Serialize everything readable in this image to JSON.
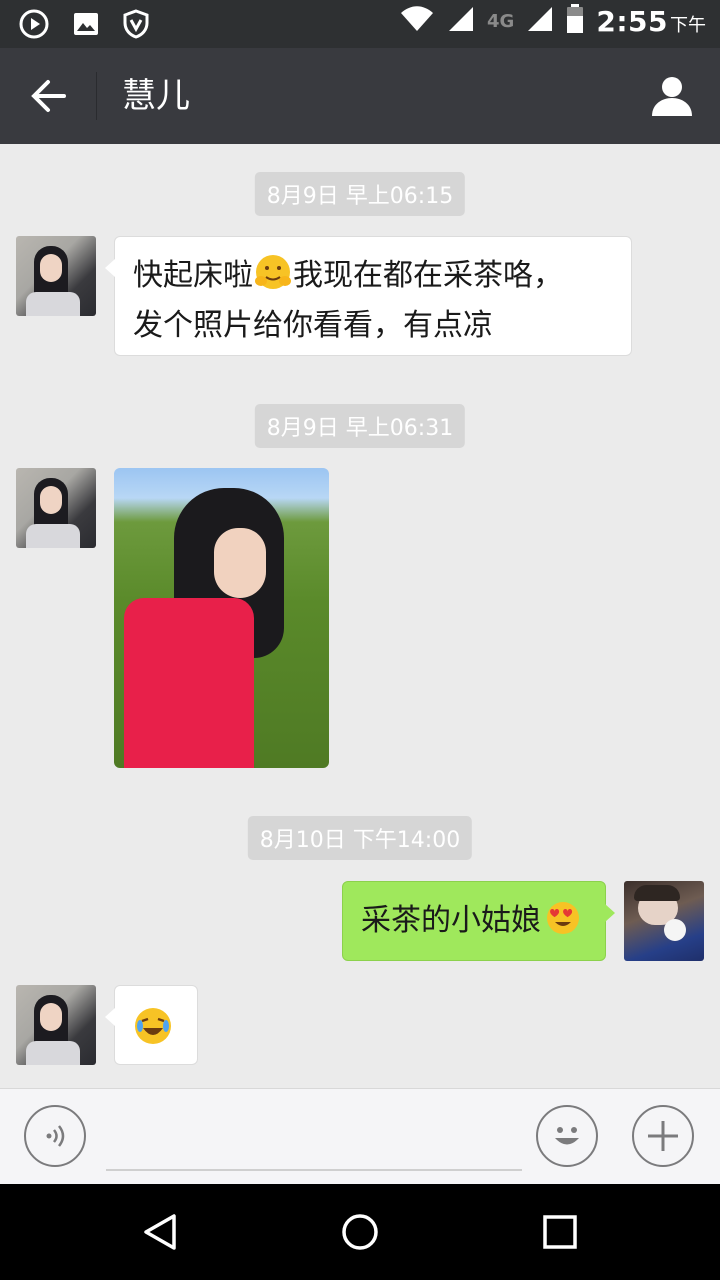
{
  "status_bar": {
    "time": "2:55",
    "time_suffix": "下午",
    "network": "4G",
    "icons": [
      "play-store-icon",
      "image-icon",
      "shield-icon",
      "wifi-icon",
      "signal-icon",
      "battery-icon"
    ]
  },
  "header": {
    "title": "慧儿",
    "back_icon": "back-arrow-icon",
    "contact_icon": "contact-profile-icon"
  },
  "messages": [
    {
      "type": "timestamp",
      "text": "8月9日 早上06:15"
    },
    {
      "type": "text",
      "from": "contact",
      "line1": "快起床啦",
      "line1_after_emoji": "我现在都在采茶咯，",
      "line2": "发个照片给你看看，有点凉",
      "emoji": "hug-emoji"
    },
    {
      "type": "timestamp",
      "text": "8月9日 早上06:31"
    },
    {
      "type": "image",
      "from": "contact",
      "description_icon": "photo-tea-garden"
    },
    {
      "type": "timestamp",
      "text": "8月10日 下午14:00"
    },
    {
      "type": "text",
      "from": "me",
      "text": "采茶的小姑娘",
      "emoji": "heart-eyes-emoji"
    },
    {
      "type": "emoji",
      "from": "contact",
      "emoji": "laugh-cry-emoji"
    }
  ],
  "input_bar": {
    "voice_icon": "voice-icon",
    "emoji_icon": "smiley-icon",
    "more_icon": "plus-icon",
    "input_value": ""
  },
  "colors": {
    "status_bar": "#2e3032",
    "title_bar": "#393a3f",
    "chat_bg": "#ebebeb",
    "outgoing_bubble": "#9fe85c",
    "incoming_bubble": "#ffffff",
    "timestamp_bg": "#d6d6d6"
  }
}
